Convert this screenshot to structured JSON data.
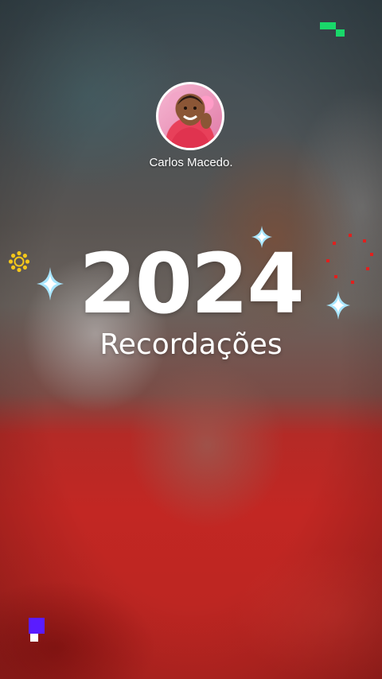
{
  "profile": {
    "name": "Carlos Macedo."
  },
  "title": {
    "year": "2024",
    "subtitle": "Recordações"
  },
  "colors": {
    "shirt_red": "#c22723",
    "text": "#ffffff",
    "sparkle_blue": "#a8e6ff",
    "sparkle_gold": "#f5c81a",
    "dots_red": "#e0201e",
    "pixel_green": "#19d86a",
    "pixel_purple": "#5a1cff"
  },
  "decorations": [
    "sparkle-icon",
    "sparkle-icon",
    "sparkle-icon",
    "sunburst-icon",
    "red-dot-ring",
    "green-pixel-logo",
    "purple-pixel-logo"
  ]
}
